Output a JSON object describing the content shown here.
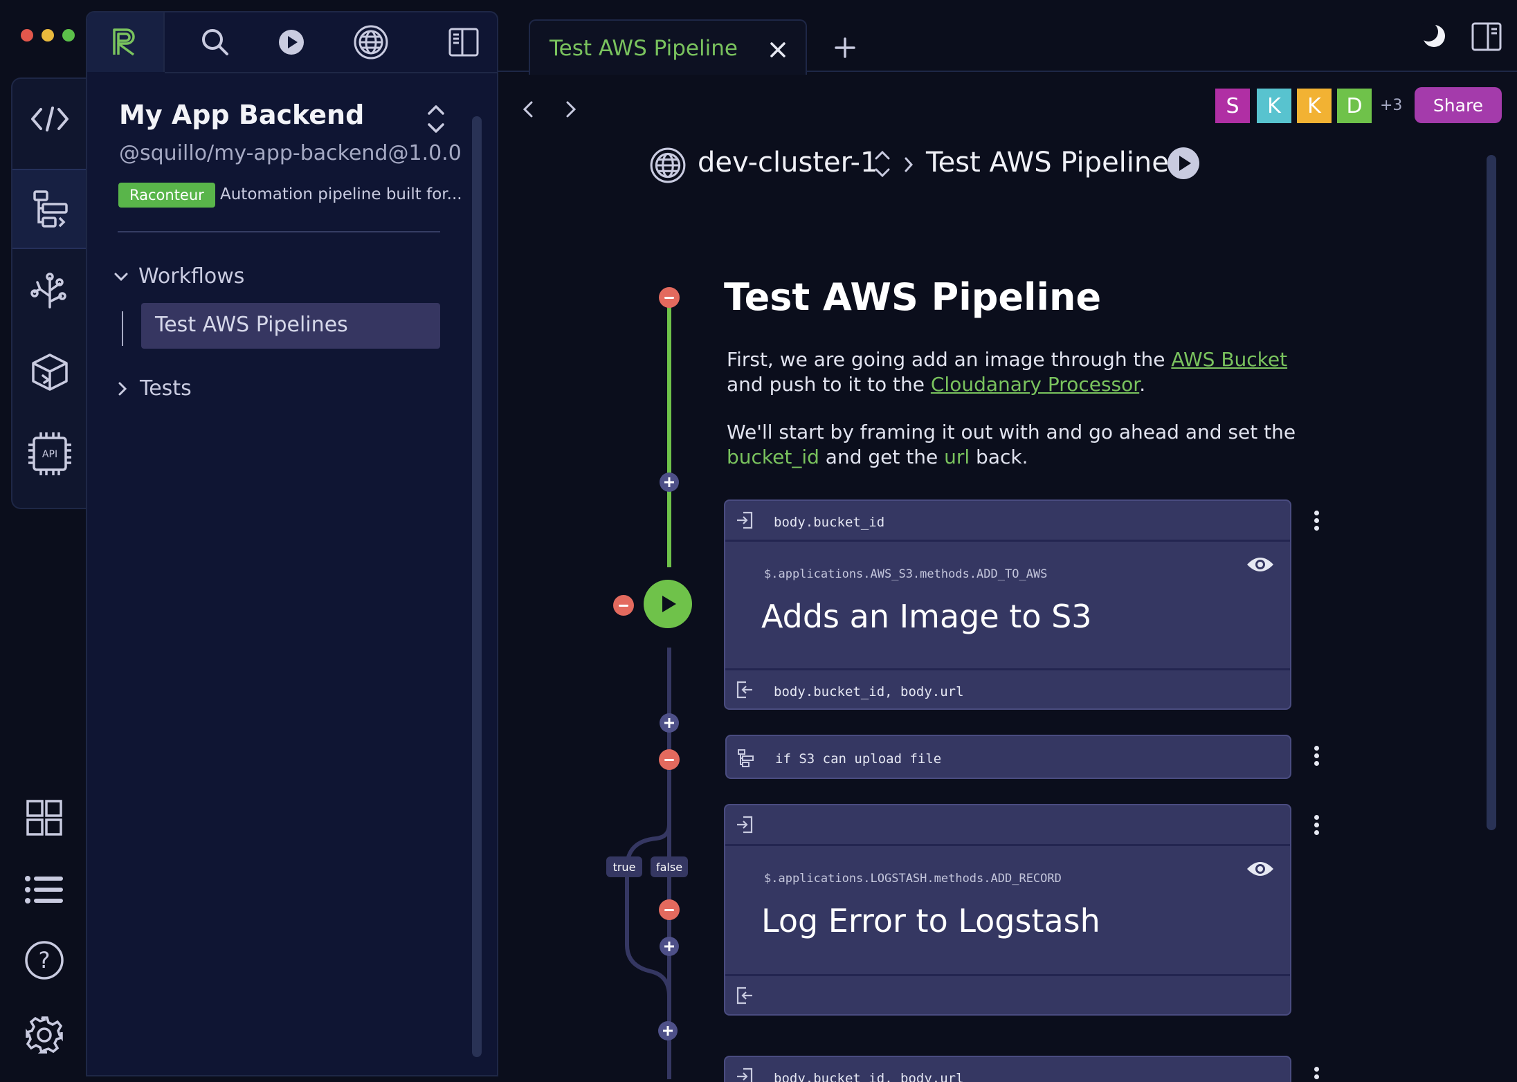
{
  "app": {
    "colors": {
      "accent_green": "#7ac35e",
      "share_purple": "#a43bab",
      "delete_red": "#e36a5e"
    }
  },
  "sidebar": {
    "project": {
      "title": "My App Backend",
      "package": "@squillo/my-app-backend@1.0.0",
      "badge": "Raconteur",
      "description": "Automation pipeline built for..."
    },
    "tree": {
      "workflows_label": "Workflows",
      "workflow_item": "Test AWS Pipelines",
      "tests_label": "Tests"
    }
  },
  "tabs": {
    "active_label": "Test AWS Pipeline"
  },
  "collaborators": {
    "avatars": [
      {
        "initial": "S",
        "color": "#b02fa4"
      },
      {
        "initial": "K",
        "color": "#58c3cf"
      },
      {
        "initial": "K",
        "color": "#f2b233"
      },
      {
        "initial": "D",
        "color": "#6fc24a"
      }
    ],
    "more": "+3",
    "share_label": "Share"
  },
  "breadcrumb": {
    "cluster": "dev-cluster-1",
    "pipeline": "Test AWS Pipeline"
  },
  "doc": {
    "title": "Test AWS Pipeline",
    "p1": {
      "before": "First, we are going add an image through the ",
      "link1": "AWS Bucket",
      "mid": " and push to it to the ",
      "link2": "Cloudanary Processor",
      "after": "."
    },
    "p2": {
      "before": "We'll start by framing it out with and go ahead and set the ",
      "var1": "bucket_id",
      "mid": " and get the ",
      "var2": "url",
      "after": " back."
    }
  },
  "steps": {
    "step1": {
      "input": "body.bucket_id",
      "method": "$.applications.AWS_S3.methods.ADD_TO_AWS",
      "title": "Adds an Image to S3",
      "output": "body.bucket_id, body.url"
    },
    "condition": {
      "label": "if S3 can upload file"
    },
    "branches": {
      "true_label": "true",
      "false_label": "false"
    },
    "step2": {
      "input": "",
      "method": "$.applications.LOGSTASH.methods.ADD_RECORD",
      "title": "Log Error to Logstash",
      "output": ""
    },
    "step3": {
      "input": "body.bucket_id, body.url"
    }
  }
}
